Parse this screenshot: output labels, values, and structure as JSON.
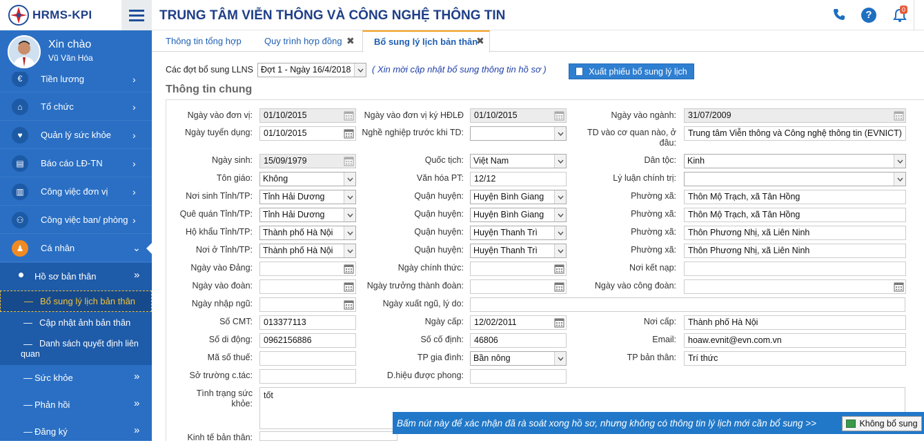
{
  "app": {
    "logo_text": "HRMS-KPI",
    "title": "TRUNG TÂM VIỄN THÔNG VÀ CÔNG NGHỆ THÔNG TIN",
    "notifications_count": "0"
  },
  "user": {
    "greeting": "Xin chào",
    "name": "Vũ Văn Hóa"
  },
  "sidebar": {
    "items": [
      {
        "label": "Tiền lương",
        "icon": "euro-icon"
      },
      {
        "label": "Tổ chức",
        "icon": "bank-icon"
      },
      {
        "label": "Quản lý sức khỏe",
        "icon": "heart-icon"
      },
      {
        "label": "Báo cáo LĐ-TN",
        "icon": "id-card-icon"
      },
      {
        "label": "Công việc đơn vị",
        "icon": "building-icon"
      },
      {
        "label": "Công việc ban/ phòng",
        "icon": "users-icon"
      },
      {
        "label": "Cá nhân",
        "icon": "person-icon"
      }
    ],
    "sub_items": [
      {
        "label": "Hồ sơ bản thân"
      },
      {
        "label": "Sức khỏe"
      },
      {
        "label": "Phản hồi"
      },
      {
        "label": "Đăng ký"
      }
    ],
    "sub_sub_items": [
      {
        "label": "Bổ sung lý lịch bản thân"
      },
      {
        "label": "Cập nhật ảnh bản thân"
      },
      {
        "label": "Danh sách quyết định liên quan"
      }
    ]
  },
  "tabs": [
    {
      "label": "Thông tin tổng hợp"
    },
    {
      "label": "Quy trình hợp đồng"
    },
    {
      "label": "Bổ sung lý lịch bản thân"
    }
  ],
  "toolbar": {
    "period_label": "Các đợt bổ sung LLNS",
    "period_value": "Đợt 1 - Ngày 16/4/2018",
    "note": "( Xin mời cập nhật bổ sung thông tin hồ sơ )",
    "export_label": "Xuất phiếu bổ sung lý lịch"
  },
  "section_title": "Thông tin chung",
  "form": {
    "ngay_vao_don_vi": {
      "label": "Ngày vào đơn vị:",
      "value": "01/10/2015"
    },
    "ngay_vao_dv_ky_hdld": {
      "label": "Ngày vào đơn vị ký HĐLĐ",
      "value": "01/10/2015"
    },
    "ngay_vao_nganh": {
      "label": "Ngày vào ngành:",
      "value": "31/07/2009"
    },
    "ngay_tuyen_dung": {
      "label": "Ngày tuyển dụng:",
      "value": "01/10/2015"
    },
    "nghe_nghiep": {
      "label": "Nghề nghiệp trước khi TD:",
      "value": ""
    },
    "td_vao_co_quan": {
      "label": "TD vào cơ quan nào, ở đâu:",
      "value": "Trung tâm Viễn thông và Công nghệ thông tin (EVNICT)"
    },
    "ngay_sinh": {
      "label": "Ngày sinh:",
      "value": "15/09/1979"
    },
    "quoc_tich": {
      "label": "Quốc tịch:",
      "value": "Việt Nam"
    },
    "dan_toc": {
      "label": "Dân tộc:",
      "value": "Kinh"
    },
    "ton_giao": {
      "label": "Tôn giáo:",
      "value": "Không"
    },
    "van_hoa": {
      "label": "Văn hóa PT:",
      "value": "12/12"
    },
    "ly_luan": {
      "label": "Lý luận chính trị:",
      "value": ""
    },
    "noi_sinh": {
      "label": "Nơi sinh Tỉnh/TP:",
      "value": "Tỉnh Hải Dương"
    },
    "noi_sinh_qh": {
      "label": "Quận huyện:",
      "value": "Huyện Bình Giang"
    },
    "noi_sinh_px": {
      "label": "Phường xã:",
      "value": "Thôn Mộ Trạch, xã Tân Hồng"
    },
    "que_quan": {
      "label": "Quê quán Tỉnh/TP:",
      "value": "Tỉnh Hải Dương"
    },
    "que_quan_qh": {
      "label": "Quận huyện:",
      "value": "Huyện Bình Giang"
    },
    "que_quan_px": {
      "label": "Phường xã:",
      "value": "Thôn Mộ Trạch, xã Tân Hồng"
    },
    "ho_khau": {
      "label": "Hộ khẩu Tỉnh/TP:",
      "value": "Thành phố Hà Nội"
    },
    "ho_khau_qh": {
      "label": "Quận huyện:",
      "value": "Huyện Thanh Trì"
    },
    "ho_khau_px": {
      "label": "Phường xã:",
      "value": "Thôn Phương Nhị, xã Liên Ninh"
    },
    "noi_o": {
      "label": "Nơi ở Tỉnh/TP:",
      "value": "Thành phố Hà Nội"
    },
    "noi_o_qh": {
      "label": "Quận huyện:",
      "value": "Huyện Thanh Trì"
    },
    "noi_o_px": {
      "label": "Phường xã:",
      "value": "Thôn Phương Nhị, xã Liên Ninh"
    },
    "ngay_vao_dang": {
      "label": "Ngày vào Đảng:",
      "value": ""
    },
    "ngay_chinh_thuc": {
      "label": "Ngày chính thức:",
      "value": ""
    },
    "noi_ket_nap": {
      "label": "Nơi kết nạp:",
      "value": ""
    },
    "ngay_vao_doan": {
      "label": "Ngày vào đoàn:",
      "value": ""
    },
    "ngay_truong_thanh": {
      "label": "Ngày trưởng thành đoàn:",
      "value": ""
    },
    "ngay_cong_doan": {
      "label": "Ngày vào công đoàn:",
      "value": ""
    },
    "ngay_nhap_ngu": {
      "label": "Ngày nhập ngũ:",
      "value": ""
    },
    "ngay_xuat_ngu": {
      "label": "Ngày xuất ngũ, lý do:",
      "value": ""
    },
    "so_cmt": {
      "label": "Số CMT:",
      "value": "013377113"
    },
    "ngay_cap": {
      "label": "Ngày cấp:",
      "value": "12/02/2011"
    },
    "noi_cap": {
      "label": "Nơi cấp:",
      "value": "Thành phố Hà Nội"
    },
    "so_di_dong": {
      "label": "Số di động:",
      "value": "0962156886"
    },
    "so_co_dinh": {
      "label": "Số cố định:",
      "value": "46806"
    },
    "email": {
      "label": "Email:",
      "value": "hoaw.evnit@evn.com.vn"
    },
    "ma_so_thue": {
      "label": "Mã số thuế:",
      "value": ""
    },
    "tp_gia_dinh": {
      "label": "TP gia đình:",
      "value": "Bần nông"
    },
    "tp_ban_than": {
      "label": "TP bản thân:",
      "value": "Trí thức"
    },
    "so_truong": {
      "label": "Sở trường c.tác:",
      "value": ""
    },
    "danh_hieu": {
      "label": "D.hiệu được phong:",
      "value": ""
    },
    "tinh_trang_sk": {
      "label": "Tình trạng sức khỏe:",
      "value": "tốt"
    },
    "kinh_te": {
      "label": "Kinh tế bản thân:",
      "value": ""
    }
  },
  "banner": {
    "text": "Bấm nút này để xác nhận đã rà soát xong hồ sơ, nhưng không có thông tin lý lịch mới cần bổ sung >>",
    "button_label": "Không bổ sung"
  },
  "colors": {
    "sidebar": "#2a6fc4",
    "brand": "#1f3f87",
    "highlight": "#f4c23a",
    "banner": "#2178c8"
  }
}
